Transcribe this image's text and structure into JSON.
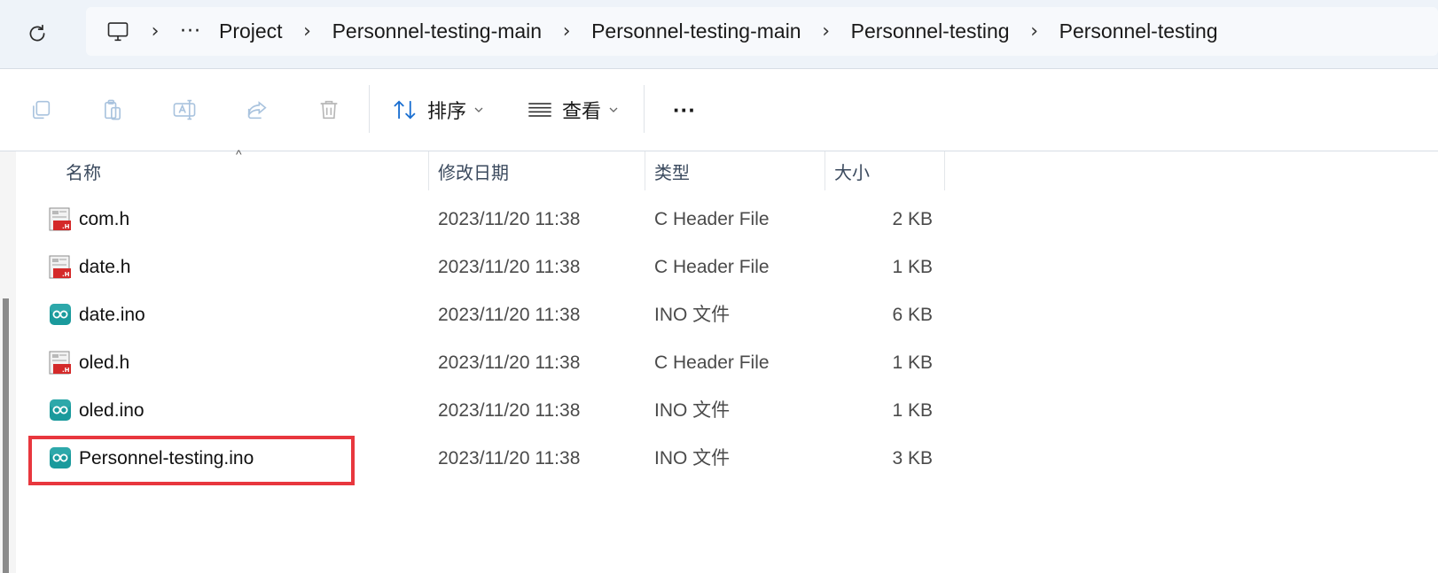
{
  "address_bar": {
    "overflow_label": "···",
    "crumbs": [
      "Project",
      "Personnel-testing-main",
      "Personnel-testing-main",
      "Personnel-testing",
      "Personnel-testing"
    ],
    "separator": "›"
  },
  "toolbar": {
    "sort_label": "排序",
    "view_label": "查看",
    "more_label": "···"
  },
  "columns": {
    "name": "名称",
    "date": "修改日期",
    "type": "类型",
    "size": "大小"
  },
  "files": [
    {
      "name": "com.h",
      "date": "2023/11/20 11:38",
      "type": "C Header File",
      "size": "2 KB",
      "icon": "c-header-file-icon"
    },
    {
      "name": "date.h",
      "date": "2023/11/20 11:38",
      "type": "C Header File",
      "size": "1 KB",
      "icon": "c-header-file-icon"
    },
    {
      "name": "date.ino",
      "date": "2023/11/20 11:38",
      "type": "INO 文件",
      "size": "6 KB",
      "icon": "arduino-file-icon"
    },
    {
      "name": "oled.h",
      "date": "2023/11/20 11:38",
      "type": "C Header File",
      "size": "1 KB",
      "icon": "c-header-file-icon"
    },
    {
      "name": "oled.ino",
      "date": "2023/11/20 11:38",
      "type": "INO 文件",
      "size": "1 KB",
      "icon": "arduino-file-icon"
    },
    {
      "name": "Personnel-testing.ino",
      "date": "2023/11/20 11:38",
      "type": "INO 文件",
      "size": "3 KB",
      "icon": "arduino-file-icon"
    }
  ],
  "colors": {
    "highlight_box": "#e8373e",
    "arduino_teal": "#1a9a9c",
    "header_red": "#d42a2a",
    "accent_blue": "#1a6fd1"
  }
}
